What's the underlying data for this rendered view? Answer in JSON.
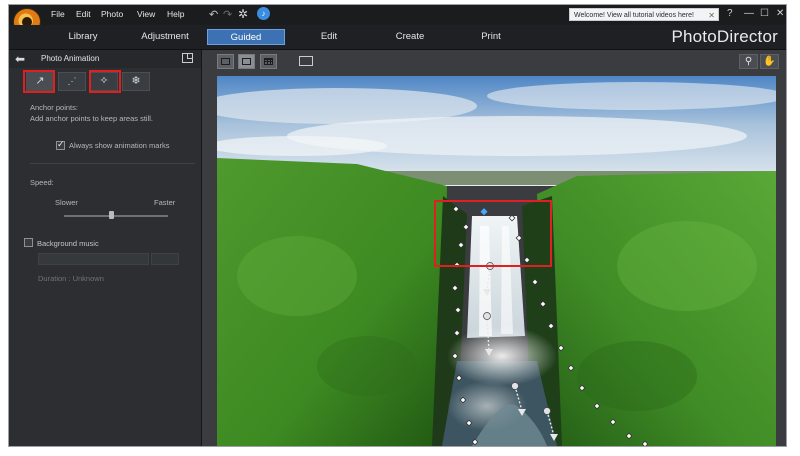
{
  "app": {
    "brand": "PhotoDirector"
  },
  "menubar": {
    "items": [
      "File",
      "Edit",
      "Photo",
      "View",
      "Help"
    ],
    "undo_icon": "undo-icon",
    "redo_icon": "redo-icon",
    "welcome_message": "Welcome! View all tutorial videos here!",
    "close_glyph": "✕",
    "help_glyph": "?",
    "minimize_glyph": "—",
    "maximize_glyph": "☐",
    "close_window_glyph": "✕"
  },
  "tabs": [
    {
      "label": "Library",
      "active": false
    },
    {
      "label": "Adjustment",
      "active": false
    },
    {
      "label": "Guided",
      "active": true
    },
    {
      "label": "Edit",
      "active": false
    },
    {
      "label": "Create",
      "active": false
    },
    {
      "label": "Print",
      "active": false
    }
  ],
  "panel": {
    "title": "Photo Animation",
    "tools": [
      {
        "icon": "motion-arrow-icon",
        "highlighted": true
      },
      {
        "icon": "anchor-path-icon",
        "highlighted": false
      },
      {
        "icon": "magic-wand-icon",
        "highlighted": true
      },
      {
        "icon": "freeze-icon",
        "highlighted": false
      }
    ],
    "anchor_heading": "Anchor points:",
    "anchor_desc": "Add anchor points to keep areas still.",
    "always_show_label": "Always show animation marks",
    "always_show_checked": true,
    "speed_label": "Speed:",
    "slower_label": "Slower",
    "faster_label": "Faster",
    "speed_value": 0.45,
    "bg_music_label": "Background music",
    "bg_music_checked": false,
    "duration_label": "Duration : Unknown"
  },
  "view": {
    "toolbar_icons": [
      "single-view-icon",
      "fit-view-icon",
      "grid-view-icon",
      "compare-icon"
    ],
    "zoom_icon": "zoom-icon",
    "pan_icon": "hand-pan-icon"
  },
  "colors": {
    "accent": "#3c72b3",
    "highlight_red": "#e02020"
  }
}
